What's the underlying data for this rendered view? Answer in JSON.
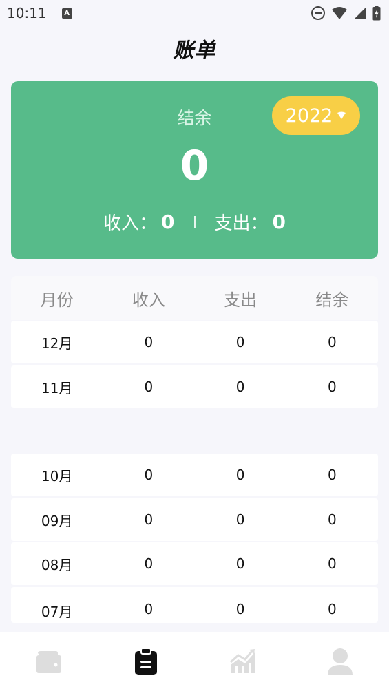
{
  "status_bar": {
    "time": "10:11",
    "notification_letter": "A",
    "icons": [
      "do-not-disturb-icon",
      "wifi-icon",
      "signal-icon",
      "battery-icon"
    ]
  },
  "page": {
    "title": "账单"
  },
  "balance_card": {
    "label": "结余",
    "amount": "0",
    "income_label": "收入：",
    "income_value": "0",
    "expense_label": "支出：",
    "expense_value": "0",
    "year": "2022",
    "color": "#57bb8a",
    "year_pill_color": "#f8cf46"
  },
  "table": {
    "headers": [
      "月份",
      "收入",
      "支出",
      "结余"
    ],
    "rows": [
      [
        "12月",
        "0",
        "0",
        "0"
      ],
      [
        "11月",
        "0",
        "0",
        "0"
      ],
      [
        "10月",
        "0",
        "0",
        "0"
      ],
      [
        "09月",
        "0",
        "0",
        "0"
      ],
      [
        "08月",
        "0",
        "0",
        "0"
      ],
      [
        "07月",
        "0",
        "0",
        "0"
      ]
    ]
  },
  "tab_bar": {
    "tabs": [
      {
        "icon": "wallet-icon",
        "active": false
      },
      {
        "icon": "clipboard-icon",
        "active": true
      },
      {
        "icon": "chart-icon",
        "active": false
      },
      {
        "icon": "user-icon",
        "active": false
      }
    ]
  }
}
